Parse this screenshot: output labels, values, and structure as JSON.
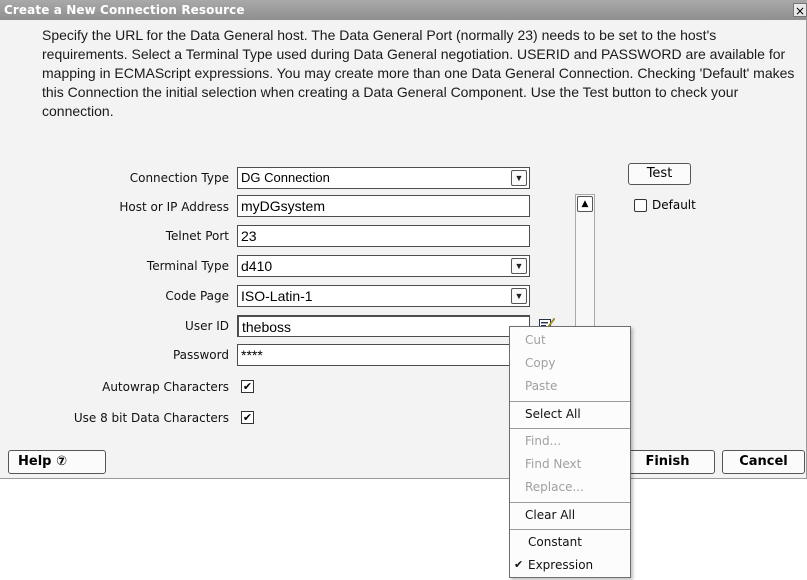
{
  "window": {
    "title": "Create a New Connection Resource",
    "close_label": "×"
  },
  "description": "Specify the URL for the Data General host.  The Data General Port (normally 23) needs to be set to the host's requirements.  Select a Terminal Type used during Data General negotiation. USERID and PASSWORD are available for mapping in ECMAScript expressions.  You may create more than one Data General Connection. Checking 'Default' makes this Connection the initial selection when creating a Data General Component. Use the Test button to check your connection.",
  "form": {
    "connection_type": {
      "label": "Connection Type",
      "value": "DG Connection"
    },
    "host": {
      "label": "Host or IP Address",
      "value": "myDGsystem"
    },
    "port": {
      "label": "Telnet Port",
      "value": "23"
    },
    "terminal_type": {
      "label": "Terminal Type",
      "value": "d410"
    },
    "code_page": {
      "label": "Code Page",
      "value": "ISO-Latin-1"
    },
    "user_id": {
      "label": "User ID",
      "value": "theboss"
    },
    "password": {
      "label": "Password",
      "value": "****"
    },
    "autowrap": {
      "label": "Autowrap Characters",
      "checked": true
    },
    "use8bit": {
      "label": "Use 8 bit Data Characters",
      "checked": true
    }
  },
  "side": {
    "test_label": "Test",
    "default_label": "Default",
    "default_checked": false
  },
  "footer": {
    "help_label": "Help ⑦",
    "finish_label": "Finish",
    "cancel_label": "Cancel"
  },
  "context_menu": {
    "items": [
      {
        "label": "Cut",
        "enabled": false
      },
      {
        "label": "Copy",
        "enabled": false
      },
      {
        "label": "Paste",
        "enabled": false
      },
      {
        "label": "Select All",
        "enabled": true
      },
      {
        "label": "Find...",
        "enabled": false
      },
      {
        "label": "Find Next",
        "enabled": false
      },
      {
        "label": "Replace...",
        "enabled": false
      },
      {
        "label": "Clear All",
        "enabled": true
      },
      {
        "label": "Constant",
        "enabled": true
      },
      {
        "label": "Expression",
        "enabled": true,
        "checked": true
      }
    ],
    "check_glyph": "✔"
  },
  "icons": {
    "dropdown": "chevron-down-icon",
    "scroll_up": "chevron-up-icon",
    "edit": "edit-expression-icon",
    "checkbox_mark": "✔"
  }
}
